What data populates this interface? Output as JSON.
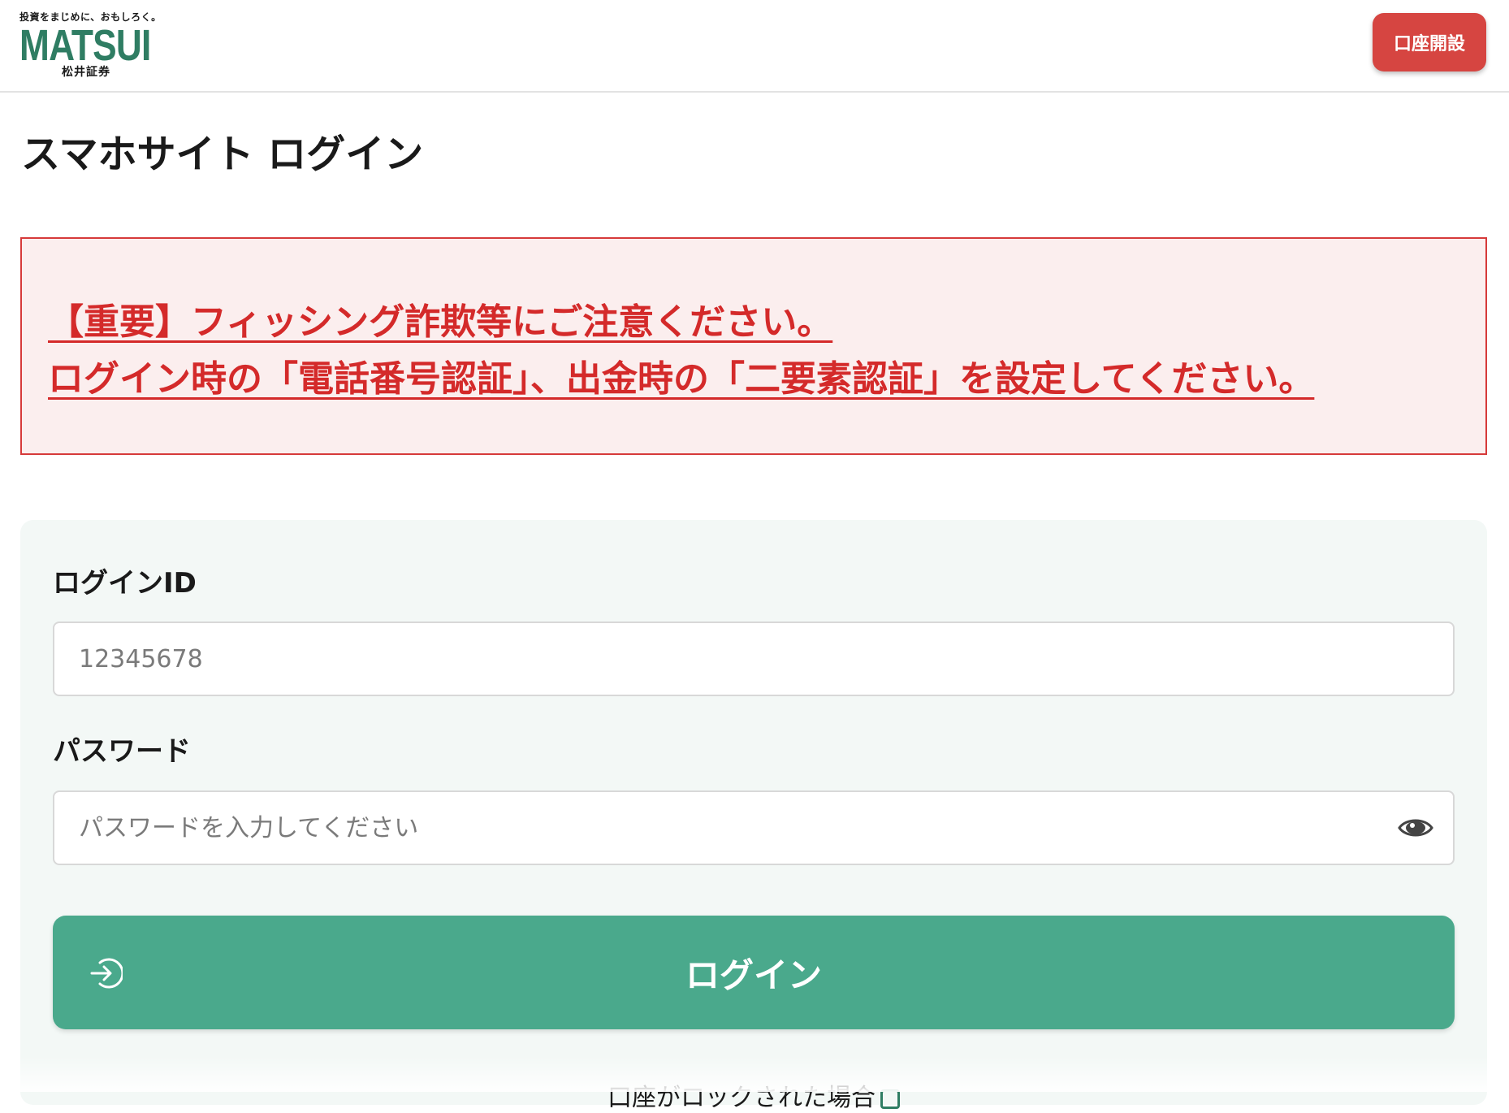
{
  "header": {
    "logo": {
      "tagline": "投資をまじめに、おもしろく。",
      "brand": "MATSUI",
      "sub": "松井証券"
    },
    "open_account_label": "口座開設"
  },
  "page_title": "スマホサイト ログイン",
  "notice": {
    "line1": "【重要】フィッシング詐欺等にご注意ください。",
    "line2": "ログイン時の「電話番号認証」、出金時の「二要素認証」を設定してください。"
  },
  "form": {
    "login_id_label": "ログインID",
    "login_id_placeholder": "12345678",
    "password_label": "パスワード",
    "password_placeholder": "パスワードを入力してください",
    "login_button_label": "ログイン",
    "locked_link": "口座がロックされた場合"
  },
  "colors": {
    "brand_green": "#2f7d63",
    "button_green": "#4aa98c",
    "alert_red": "#d42a2a",
    "open_button_red": "#d64541"
  },
  "icons": [
    "eye-icon",
    "login-arrow-icon",
    "external-link-icon"
  ]
}
